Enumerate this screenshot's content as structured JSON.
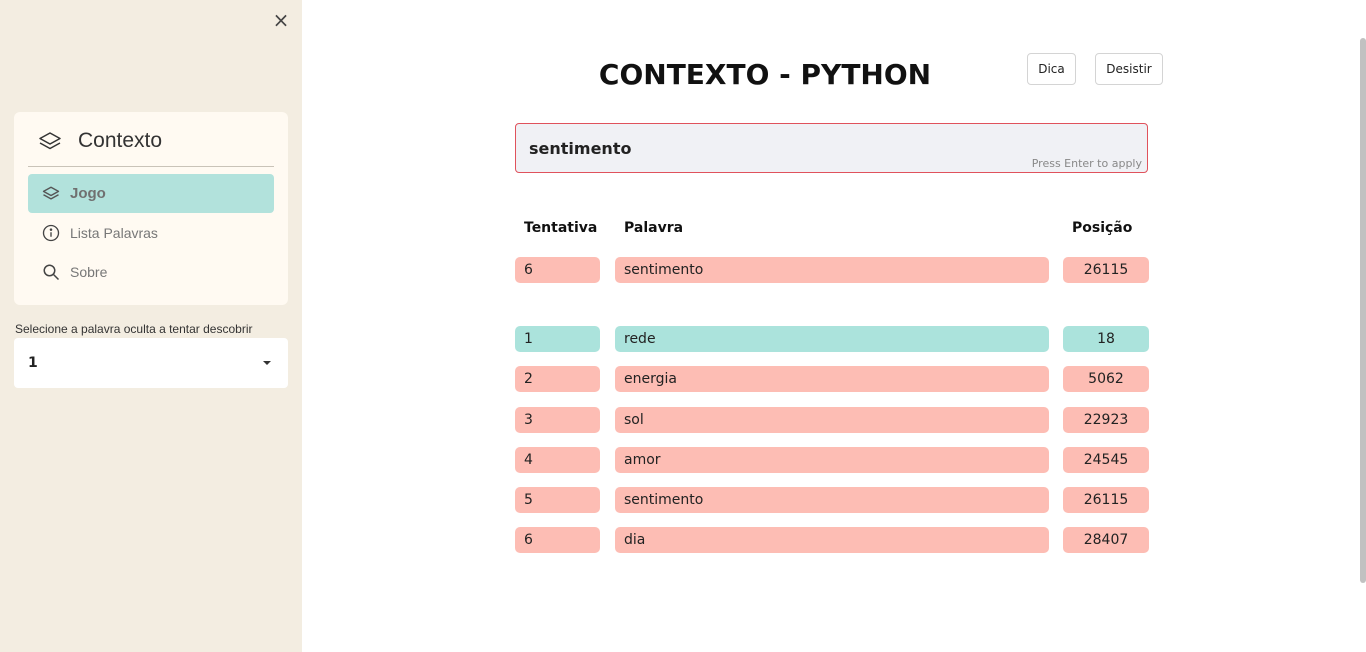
{
  "sidebar": {
    "close_label": "×",
    "menu": {
      "title": "Contexto",
      "title_icon": "layers-icon",
      "items": [
        {
          "label": "Jogo",
          "icon": "layers-icon",
          "active": true
        },
        {
          "label": "Lista Palavras",
          "icon": "info-icon",
          "active": false
        },
        {
          "label": "Sobre",
          "icon": "search-icon",
          "active": false
        }
      ]
    },
    "select": {
      "label": "Selecione a palavra oculta a tentar descobrir",
      "value": "1"
    }
  },
  "main": {
    "title": "CONTEXTO - PYTHON",
    "buttons": {
      "dica": "Dica",
      "desistir": "Desistir"
    },
    "guess": {
      "value": "sentimento",
      "hint": "Press Enter to apply"
    },
    "table": {
      "headers": {
        "tentativa": "Tentativa",
        "palavra": "Palavra",
        "posicao": "Posição"
      },
      "latest": {
        "tentativa": "6",
        "palavra": "sentimento",
        "posicao": "26115",
        "status": "red"
      },
      "rows": [
        {
          "tentativa": "1",
          "palavra": "rede",
          "posicao": "18",
          "status": "green"
        },
        {
          "tentativa": "2",
          "palavra": "energia",
          "posicao": "5062",
          "status": "red"
        },
        {
          "tentativa": "3",
          "palavra": "sol",
          "posicao": "22923",
          "status": "red"
        },
        {
          "tentativa": "4",
          "palavra": "amor",
          "posicao": "24545",
          "status": "red"
        },
        {
          "tentativa": "5",
          "palavra": "sentimento",
          "posicao": "26115",
          "status": "red"
        },
        {
          "tentativa": "6",
          "palavra": "dia",
          "posicao": "28407",
          "status": "red"
        }
      ]
    }
  },
  "colors": {
    "sidebar_bg": "#f3ede1",
    "active_item": "#b2e2dc",
    "close_row": "#abe3dc",
    "far_row": "#fdbdb4",
    "input_border": "#e0525c"
  }
}
